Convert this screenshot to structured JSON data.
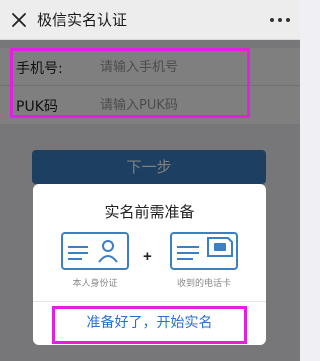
{
  "nav": {
    "title": "极信实名认证"
  },
  "form": {
    "phone_label": "手机号:",
    "phone_placeholder": "请输入手机号",
    "puk_label": "PUK码",
    "puk_placeholder": "请输入PUK码"
  },
  "next_button": "下一步",
  "modal": {
    "title": "实名前需准备",
    "plus": "+",
    "id_card_caption": "本人身份证",
    "sim_card_caption": "收到的电话卡",
    "start_button": "准备好了，开始实名"
  },
  "colors": {
    "accent": "#3b7fc4",
    "link": "#2a6fcf",
    "highlight": "#e51fe0"
  }
}
